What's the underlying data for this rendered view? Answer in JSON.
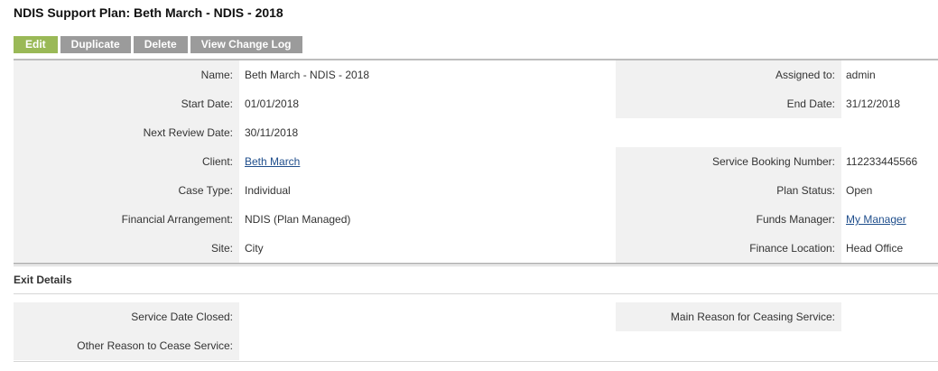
{
  "page": {
    "title": "NDIS Support Plan: Beth March - NDIS - 2018"
  },
  "toolbar": {
    "edit_label": "Edit",
    "duplicate_label": "Duplicate",
    "delete_label": "Delete",
    "change_log_label": "View Change Log"
  },
  "details": {
    "name_label": "Name:",
    "name_value": "Beth March - NDIS - 2018",
    "assigned_label": "Assigned to:",
    "assigned_value": "admin",
    "start_label": "Start Date:",
    "start_value": "01/01/2018",
    "end_label": "End Date:",
    "end_value": "31/12/2018",
    "review_label": "Next Review Date:",
    "review_value": "30/11/2018",
    "client_label": "Client:",
    "client_value": "Beth March",
    "booking_label": "Service Booking Number:",
    "booking_value": "112233445566",
    "case_label": "Case Type:",
    "case_value": "Individual",
    "status_label": "Plan Status:",
    "status_value": "Open",
    "finance_label": "Financial Arrangement:",
    "finance_value": "NDIS (Plan Managed)",
    "funds_label": "Funds Manager:",
    "funds_value": "My Manager",
    "site_label": "Site:",
    "site_value": "City",
    "location_label": "Finance Location:",
    "location_value": "Head Office"
  },
  "exit": {
    "heading": "Exit Details",
    "closed_label": "Service Date Closed:",
    "closed_value": "",
    "main_reason_label": "Main Reason for Ceasing Service:",
    "main_reason_value": "",
    "other_reason_label": "Other Reason to Cease Service:",
    "other_reason_value": ""
  }
}
